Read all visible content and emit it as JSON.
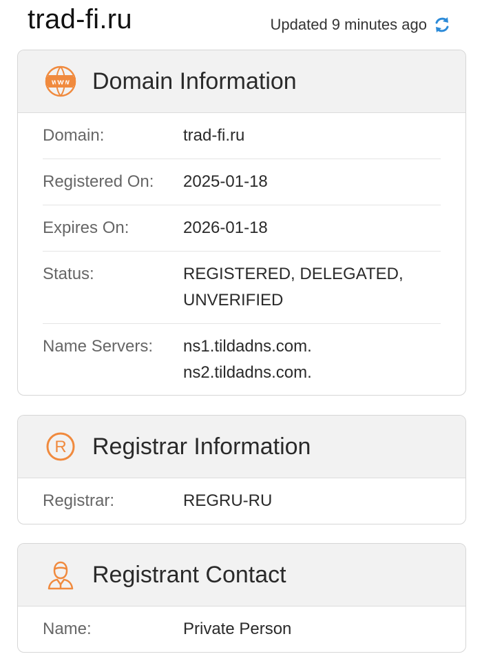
{
  "header": {
    "domain": "trad-fi.ru",
    "updated_text": "Updated 9 minutes ago",
    "refresh_icon": "refresh-icon"
  },
  "colors": {
    "accent_orange": "#f08a3e",
    "refresh_blue": "#2b8ad8"
  },
  "domain_info": {
    "title": "Domain Information",
    "icon": "www-icon",
    "rows": {
      "domain": {
        "label": "Domain:",
        "value": "trad-fi.ru"
      },
      "registered": {
        "label": "Registered On:",
        "value": "2025-01-18"
      },
      "expires": {
        "label": "Expires On:",
        "value": "2026-01-18"
      },
      "status": {
        "label": "Status:",
        "value_line1": "REGISTERED, DELEGATED,",
        "value_line2": "UNVERIFIED"
      },
      "name_servers": {
        "label": "Name Servers:",
        "ns1": "ns1.tildadns.com.",
        "ns2": "ns2.tildadns.com."
      }
    }
  },
  "registrar_info": {
    "title": "Registrar Information",
    "icon": "registered-icon",
    "rows": {
      "registrar": {
        "label": "Registrar:",
        "value": "REGRU-RU"
      }
    }
  },
  "registrant_contact": {
    "title": "Registrant Contact",
    "icon": "person-icon",
    "rows": {
      "name": {
        "label": "Name:",
        "value": "Private Person"
      }
    }
  }
}
